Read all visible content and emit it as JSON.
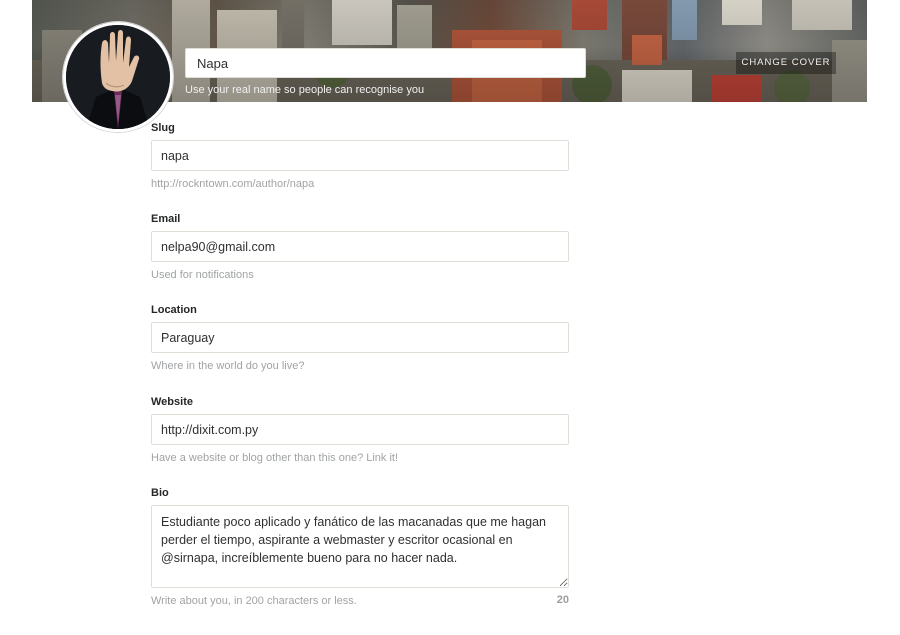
{
  "cover": {
    "change_label": "CHANGE COVER"
  },
  "profile": {
    "name_value": "Napa",
    "name_hint": "Use your real name so people can recognise you"
  },
  "fields": {
    "slug": {
      "label": "Slug",
      "value": "napa",
      "hint": "http://rockntown.com/author/napa"
    },
    "email": {
      "label": "Email",
      "value": "nelpa90@gmail.com",
      "hint": "Used for notifications"
    },
    "location": {
      "label": "Location",
      "value": "Paraguay",
      "hint": "Where in the world do you live?"
    },
    "website": {
      "label": "Website",
      "value": "http://dixit.com.py",
      "hint": "Have a website or blog other than this one? Link it!"
    },
    "bio": {
      "label": "Bio",
      "value": "Estudiante poco aplicado y fanático de las macanadas que me hagan perder el tiempo, aspirante a webmaster y escritor ocasional en @sirnapa, increíblemente bueno para no hacer nada.",
      "hint": "Write about you, in 200 characters or less.",
      "counter": "20"
    }
  },
  "colors": {
    "label": "#242628",
    "hint": "#a0a3a5",
    "border": "#e0dfd7"
  }
}
